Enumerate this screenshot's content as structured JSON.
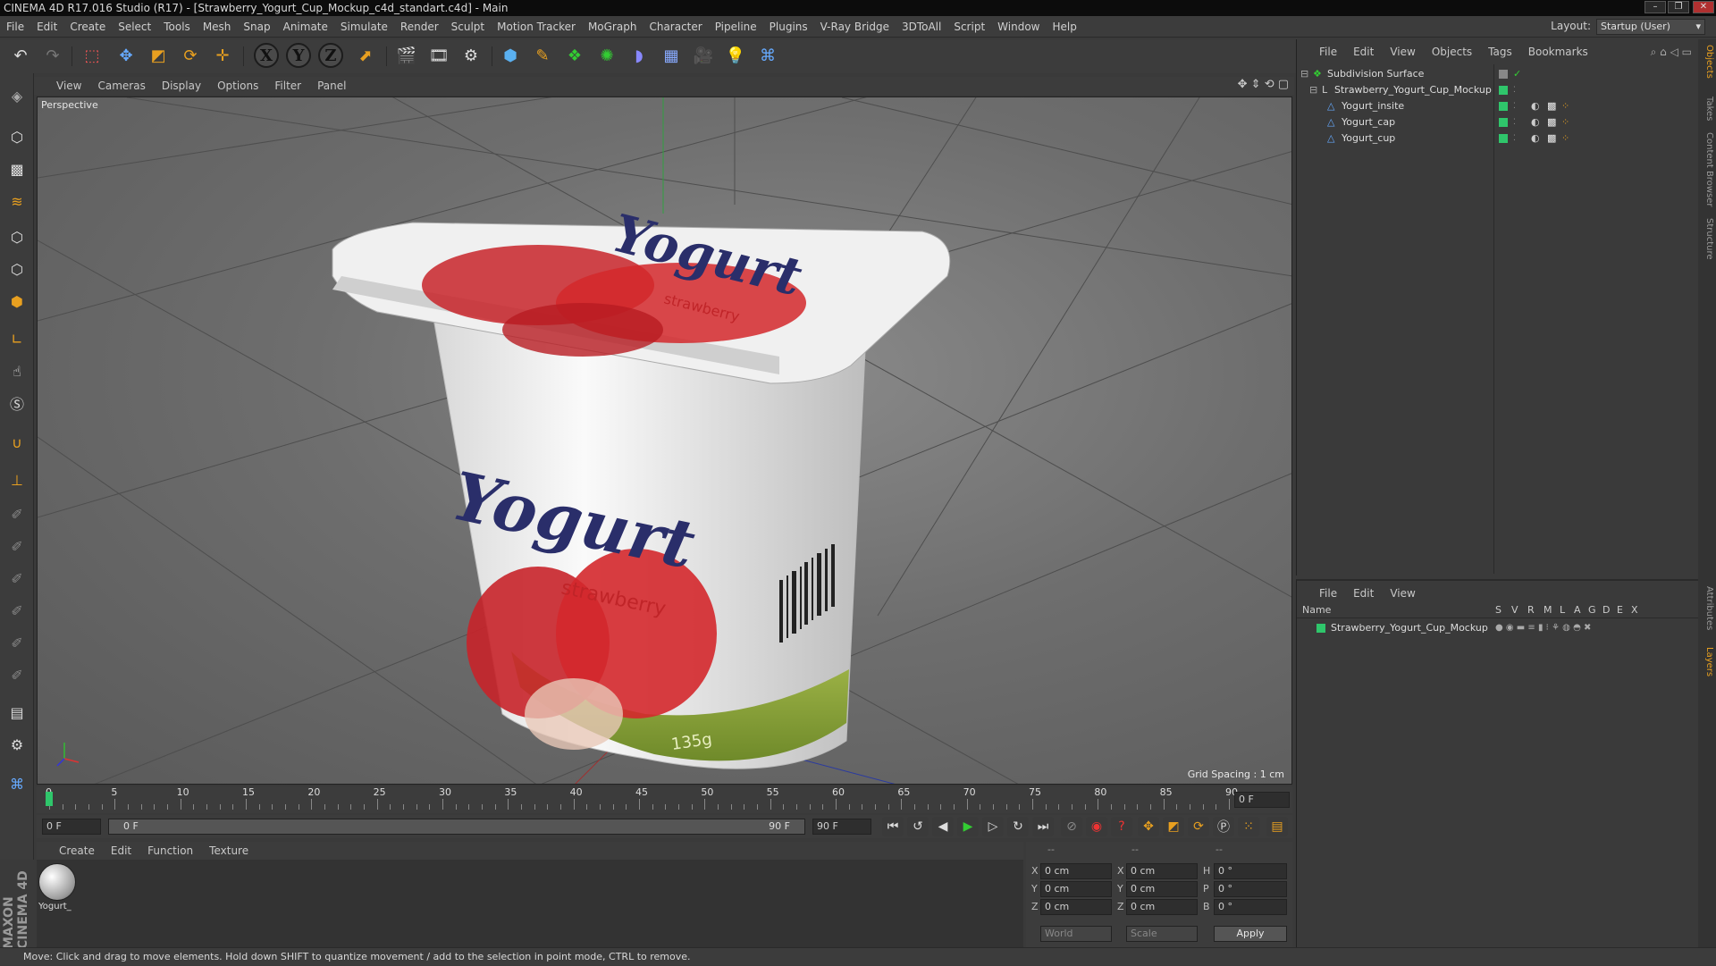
{
  "window": {
    "title": "CINEMA 4D R17.016 Studio (R17) - [Strawberry_Yogurt_Cup_Mockup_c4d_standart.c4d] - Main",
    "minimize": "–",
    "restore": "❐",
    "close": "✕"
  },
  "menu": [
    "File",
    "Edit",
    "Create",
    "Select",
    "Tools",
    "Mesh",
    "Snap",
    "Animate",
    "Simulate",
    "Render",
    "Sculpt",
    "Motion Tracker",
    "MoGraph",
    "Character",
    "Pipeline",
    "Plugins",
    "V-Ray Bridge",
    "3DToAll",
    "Script",
    "Window",
    "Help"
  ],
  "layout": {
    "label": "Layout:",
    "value": "Startup (User)"
  },
  "toolbar": {
    "x_axis": "X",
    "y_axis": "Y",
    "z_axis": "Z"
  },
  "viewport": {
    "menu": [
      "View",
      "Cameras",
      "Display",
      "Options",
      "Filter",
      "Panel"
    ],
    "label": "Perspective",
    "grid_spacing": "Grid Spacing : 1 cm",
    "lid_text": "Yogurt",
    "lid_subtext": "strawberry",
    "cup_text": "Yogurt",
    "cup_subtext": "strawberry",
    "weight_text": "135g"
  },
  "timeline": {
    "ticks": [
      "0",
      "5",
      "10",
      "15",
      "20",
      "25",
      "30",
      "35",
      "40",
      "45",
      "50",
      "55",
      "60",
      "65",
      "70",
      "75",
      "80",
      "85",
      "90"
    ],
    "current_frame": "0 F"
  },
  "transport": {
    "start_field": "0 F",
    "range_start": "0 F",
    "range_end": "90 F",
    "end_field": "90 F"
  },
  "materials": {
    "menu": [
      "Create",
      "Edit",
      "Function",
      "Texture"
    ],
    "items": [
      {
        "name": "Yogurt_"
      }
    ]
  },
  "coordinates": {
    "header": [
      "--",
      "--",
      "--"
    ],
    "rows": [
      {
        "pos_label": "X",
        "pos": "0 cm",
        "size_label": "X",
        "size": "0 cm",
        "rot_label": "H",
        "rot": "0 °"
      },
      {
        "pos_label": "Y",
        "pos": "0 cm",
        "size_label": "Y",
        "size": "0 cm",
        "rot_label": "P",
        "rot": "0 °"
      },
      {
        "pos_label": "Z",
        "pos": "0 cm",
        "size_label": "Z",
        "size": "0 cm",
        "rot_label": "B",
        "rot": "0 °"
      }
    ],
    "world": "World",
    "scale": "Scale",
    "apply": "Apply"
  },
  "objects": {
    "menu": [
      "File",
      "Edit",
      "View",
      "Objects",
      "Tags",
      "Bookmarks"
    ],
    "tree": [
      {
        "name": "Subdivision Surface",
        "level": 0
      },
      {
        "name": "Strawberry_Yogurt_Cup_Mockup",
        "level": 1
      },
      {
        "name": "Yogurt_insite",
        "level": 2
      },
      {
        "name": "Yogurt_cap",
        "level": 2
      },
      {
        "name": "Yogurt_cup",
        "level": 2
      }
    ]
  },
  "layers": {
    "menu": [
      "File",
      "Edit",
      "View"
    ],
    "columns": [
      "Name",
      "S",
      "V",
      "R",
      "M",
      "L",
      "A",
      "G",
      "D",
      "E",
      "X"
    ],
    "rows": [
      {
        "name": "Strawberry_Yogurt_Cup_Mockup"
      }
    ]
  },
  "right_tabs": [
    "Objects",
    "Takes",
    "Content Browser",
    "Structure",
    "Attributes",
    "Layers"
  ],
  "brand": "MAXON CINEMA 4D",
  "status": "Move: Click and drag to move elements. Hold down SHIFT to quantize movement / add to the selection in point mode, CTRL to remove.",
  "colors": {
    "accent_green": "#2fc66b",
    "highlight_orange": "#e8a020"
  }
}
